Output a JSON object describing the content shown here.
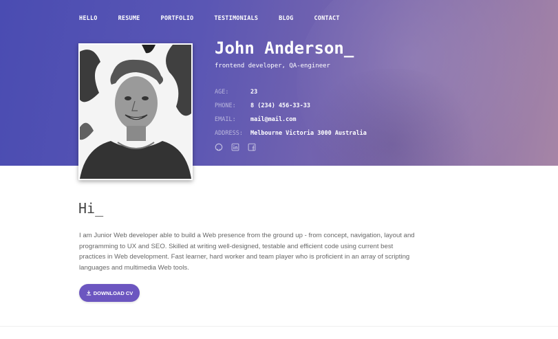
{
  "nav": {
    "items": [
      "HELLO",
      "RESUME",
      "PORTFOLIO",
      "TESTIMONIALS",
      "BLOG",
      "CONTACT"
    ]
  },
  "profile": {
    "name": "John Anderson_",
    "role": "frontend developer, QA-engineer",
    "info": [
      {
        "key": "AGE:",
        "value": "23"
      },
      {
        "key": "PHONE:",
        "value": "8 (234) 456-33-33"
      },
      {
        "key": "EMAIL:",
        "value": "mail@mail.com"
      },
      {
        "key": "ADDRESS:",
        "value": "Melbourne Victoria 3000 Australia"
      }
    ],
    "socials": [
      "github-icon",
      "linkedin-icon",
      "facebook-icon"
    ]
  },
  "about": {
    "heading": "Hi_",
    "text": "I am Junior Web developer able to build a Web presence from the ground up - from concept, navigation, layout and programming to UX and SEO. Skilled at writing well-designed, testable and efficient code using current best practices in Web development. Fast learner, hard worker and team player who is proficient in an array of scripting languages and multimedia Web tools.",
    "download_label": "DOWNLOAD CV"
  },
  "colors": {
    "hero_start": "#4a4cb2",
    "hero_end": "#a685a6",
    "accent": "#6c56c0"
  }
}
